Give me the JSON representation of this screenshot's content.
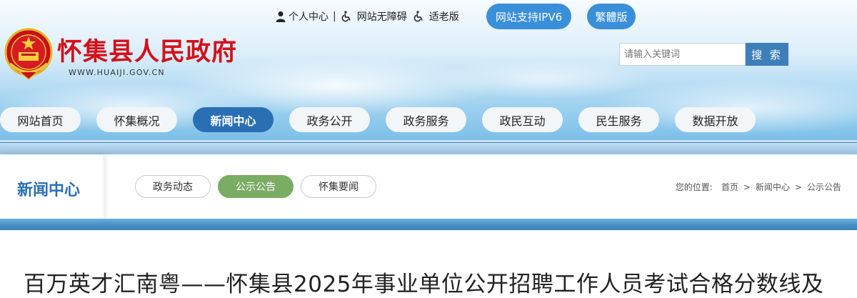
{
  "top_links": {
    "personal": "个人中心",
    "sep": "|",
    "accessible": "网站无障碍",
    "elderly": "适老版",
    "ipv6": "网站支持IPV6",
    "traditional": "繁體版"
  },
  "site": {
    "title": "怀集县人民政府",
    "url": "WWW.HUAIJI.GOV.CN"
  },
  "search": {
    "placeholder": "请输入关键词",
    "button": "搜 索"
  },
  "nav": {
    "items": [
      "网站首页",
      "怀集概况",
      "新闻中心",
      "政务公开",
      "政务服务",
      "政民互动",
      "民生服务",
      "数据开放"
    ],
    "active": "新闻中心"
  },
  "section": {
    "title": "新闻中心",
    "tabs": [
      "政务动态",
      "公示公告",
      "怀集要闻"
    ],
    "active_tab": "公示公告"
  },
  "breadcrumb": {
    "prefix": "您的位置:",
    "items": [
      "首页",
      "新闻中心",
      "公示公告"
    ],
    "sep": ">"
  },
  "article": {
    "title": "百万英才汇南粤——怀集县2025年事业单位公开招聘工作人员考试合格分数线及"
  },
  "colors": {
    "brand_red": "#d4101a",
    "primary_blue": "#2a6fb4",
    "active_green": "#7aac64"
  }
}
